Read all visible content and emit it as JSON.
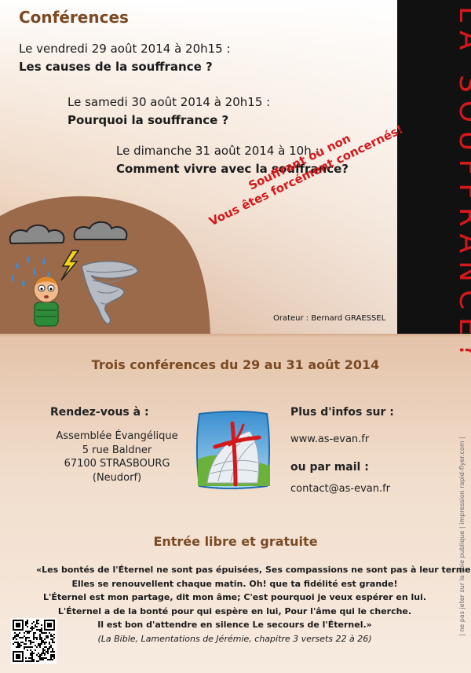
{
  "header": {
    "section_title": "Conférences"
  },
  "talks": [
    {
      "date": "Le vendredi 29 août 2014 à 20h15 :",
      "title": "Les causes de la souffrance ?"
    },
    {
      "date": "Le samedi 30 août 2014 à 20h15 :",
      "title": "Pourquoi la souffrance ?"
    },
    {
      "date": "Le dimanche 31 août 2014 à 10h :",
      "title": "Comment vivre avec la souffrance?"
    }
  ],
  "banner": {
    "vertical_title": "LA SOUFFRANCE?"
  },
  "slogan": {
    "line1": "Souffrant ou non",
    "line2": "Vous êtes forcément concernés!"
  },
  "speaker": "Orateur : Bernard GRAESSEL",
  "dates_heading": "Trois conférences du 29 au 31 août 2014",
  "rendezvous": {
    "heading": "Rendez-vous à :",
    "address": [
      "Assemblée Évangélique",
      "5 rue Baldner",
      "67100 STRASBOURG",
      "(Neudorf)"
    ]
  },
  "info": {
    "heading": "Plus d'infos sur :",
    "website": "www.as-evan.fr",
    "mail_heading": "ou par mail :",
    "email": "contact@as-evan.fr"
  },
  "entry": "Entrée libre et gratuite",
  "quote": {
    "lines": [
      "«Les bontés de l'Éternel ne sont pas épuisées, Ses compassions ne sont pas à leur terme",
      "Elles se renouvellent chaque matin. Oh! que ta fidélité est grande!",
      "L'Éternel est mon partage, dit mon âme; C'est pourquoi je veux espérer en lui.",
      "L'Éternel a de la bonté pour qui espère en lui, Pour l'âme qui le cherche.",
      "Il est bon d'attendre en silence Le secours de l'Éternel.»"
    ],
    "source": "(La Bible, Lamentations de Jérémie, chapitre 3 versets 22 à 26)"
  },
  "side_note": "| ne pas jeter sur la voie publique | impression rapid-flyer.com |",
  "colors": {
    "accent_brown": "#7a4a24",
    "accent_red": "#d4191c",
    "band_black": "#111111"
  }
}
